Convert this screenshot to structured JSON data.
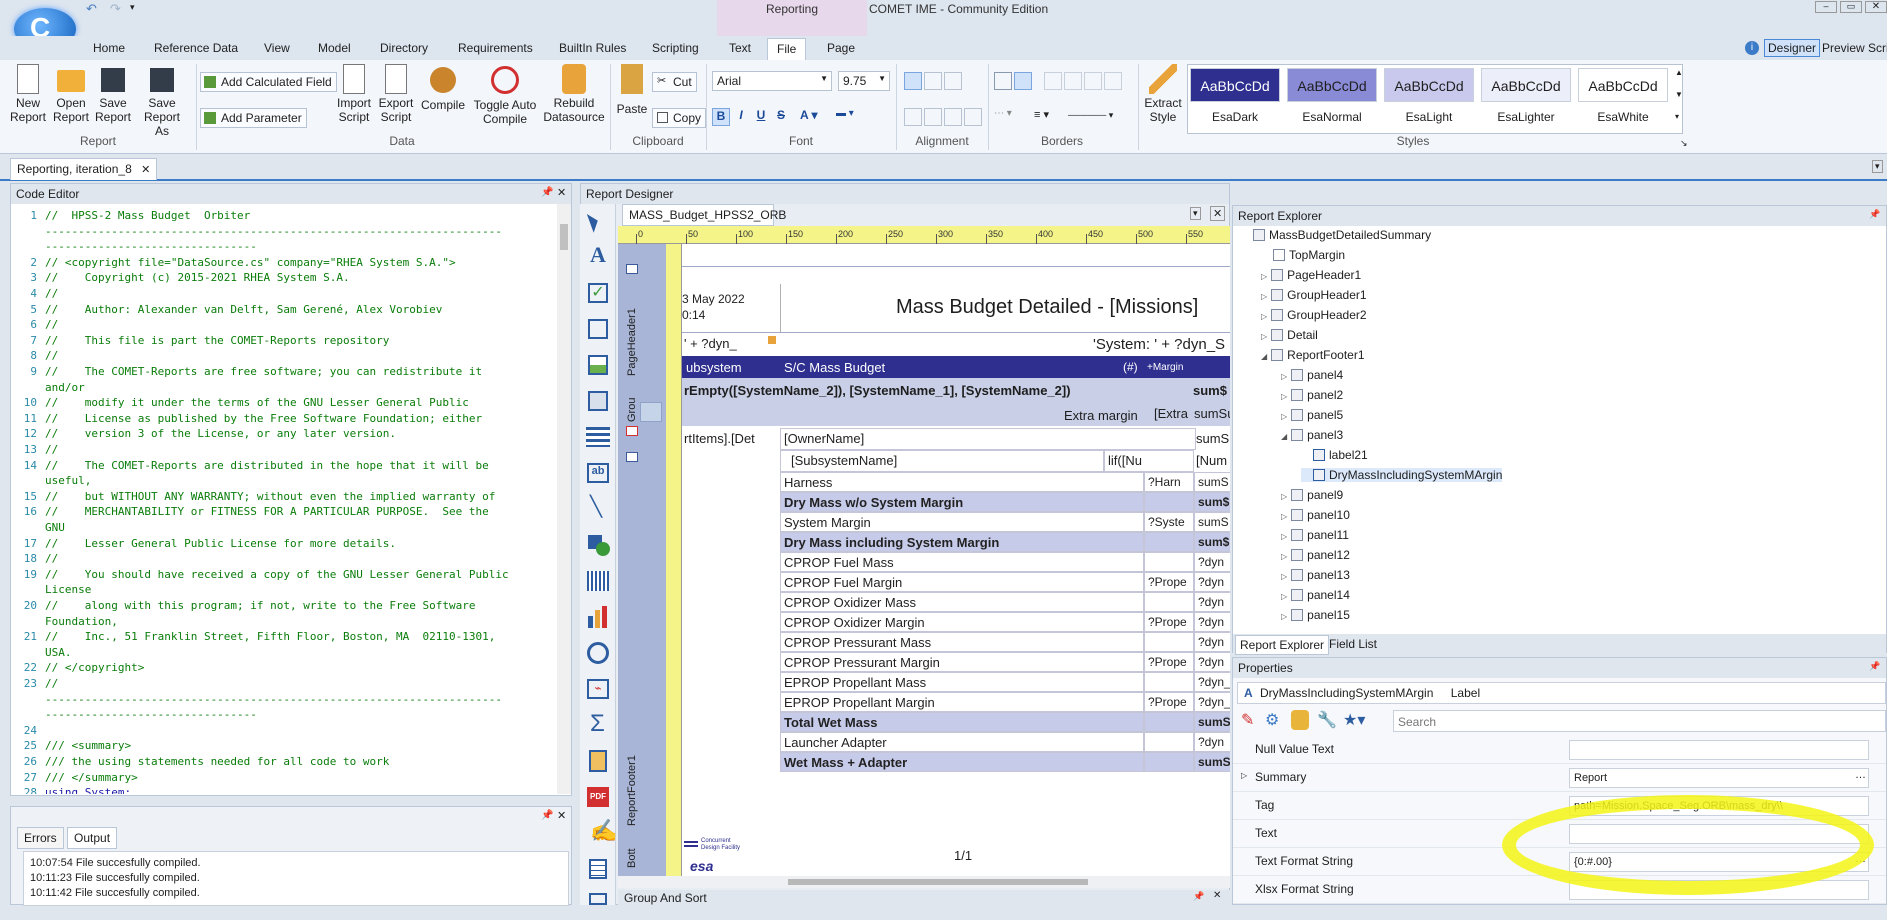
{
  "title": {
    "context_tab": "Reporting",
    "app_title": "COMET IME - Community Edition"
  },
  "ribbon": {
    "tabs": [
      "Home",
      "Reference Data",
      "View",
      "Model",
      "Directory",
      "Requirements",
      "BuiltIn Rules",
      "Scripting",
      "Text",
      "File",
      "Page"
    ],
    "active_tab": "File",
    "right": {
      "designer": "Designer",
      "preview": "Preview",
      "scripts": "Scri"
    },
    "groups": {
      "report": "Report",
      "data": "Data",
      "clipboard": "Clipboard",
      "font": "Font",
      "alignment": "Alignment",
      "borders": "Borders",
      "styles": "Styles"
    },
    "report_buttons": [
      {
        "l1": "New",
        "l2": "Report"
      },
      {
        "l1": "Open",
        "l2": "Report"
      },
      {
        "l1": "Save",
        "l2": "Report"
      },
      {
        "l1": "Save",
        "l2": "Report As"
      }
    ],
    "add_calculated_field": "Add Calculated Field",
    "add_parameter": "Add Parameter",
    "data_buttons": [
      {
        "l1": "Import",
        "l2": "Script"
      },
      {
        "l1": "Export",
        "l2": "Script"
      },
      {
        "l1": "Compile",
        "l2": ""
      },
      {
        "l1": "Toggle Auto",
        "l2": "Compile"
      },
      {
        "l1": "Rebuild",
        "l2": "Datasource"
      }
    ],
    "paste": "Paste",
    "cut": "Cut",
    "copy": "Copy",
    "font_name": "Arial",
    "font_size": "9.75",
    "extract_style": {
      "l1": "Extract",
      "l2": "Style"
    },
    "styles": [
      {
        "sample": "AaBbCcDd",
        "name": "EsaDark",
        "bg": "#2e2f8f",
        "fg": "#ffffff"
      },
      {
        "sample": "AaBbCcDd",
        "name": "EsaNormal",
        "bg": "#8a8bd6",
        "fg": "#1e1e1e"
      },
      {
        "sample": "AaBbCcDd",
        "name": "EsaLight",
        "bg": "#c9c9ee",
        "fg": "#1e1e1e"
      },
      {
        "sample": "AaBbCcDd",
        "name": "EsaLighter",
        "bg": "#eceefa",
        "fg": "#1e1e1e"
      },
      {
        "sample": "AaBbCcDd",
        "name": "EsaWhite",
        "bg": "#ffffff",
        "fg": "#1e1e1e"
      }
    ]
  },
  "doc_tab": "Reporting, iteration_8",
  "code_editor": {
    "title": "Code Editor",
    "lines": [
      {
        "n": "1",
        "t": "//  HPSS-2 Mass Budget  Orbiter"
      },
      {
        "n": "",
        "t": "---------------------------------------------------------------------"
      },
      {
        "n": "",
        "t": "--------------------------------"
      },
      {
        "n": "2",
        "t": "// <copyright file=\"DataSource.cs\" company=\"RHEA System S.A.\">"
      },
      {
        "n": "3",
        "t": "//    Copyright (c) 2015-2021 RHEA System S.A."
      },
      {
        "n": "4",
        "t": "//"
      },
      {
        "n": "5",
        "t": "//    Author: Alexander van Delft, Sam Gerené, Alex Vorobiev"
      },
      {
        "n": "6",
        "t": "//"
      },
      {
        "n": "7",
        "t": "//    This file is part the COMET-Reports repository"
      },
      {
        "n": "8",
        "t": "//"
      },
      {
        "n": "9",
        "t": "//    The COMET-Reports are free software; you can redistribute it"
      },
      {
        "n": "",
        "t": "and/or"
      },
      {
        "n": "10",
        "t": "//    modify it under the terms of the GNU Lesser General Public"
      },
      {
        "n": "11",
        "t": "//    License as published by the Free Software Foundation; either"
      },
      {
        "n": "12",
        "t": "//    version 3 of the License, or any later version."
      },
      {
        "n": "13",
        "t": "//"
      },
      {
        "n": "14",
        "t": "//    The COMET-Reports are distributed in the hope that it will be"
      },
      {
        "n": "",
        "t": "useful,"
      },
      {
        "n": "15",
        "t": "//    but WITHOUT ANY WARRANTY; without even the implied warranty of"
      },
      {
        "n": "16",
        "t": "//    MERCHANTABILITY or FITNESS FOR A PARTICULAR PURPOSE.  See the"
      },
      {
        "n": "",
        "t": "GNU"
      },
      {
        "n": "17",
        "t": "//    Lesser General Public License for more details."
      },
      {
        "n": "18",
        "t": "//"
      },
      {
        "n": "19",
        "t": "//    You should have received a copy of the GNU Lesser General Public"
      },
      {
        "n": "",
        "t": "License"
      },
      {
        "n": "20",
        "t": "//    along with this program; if not, write to the Free Software"
      },
      {
        "n": "",
        "t": "Foundation,"
      },
      {
        "n": "21",
        "t": "//    Inc., 51 Franklin Street, Fifth Floor, Boston, MA  02110-1301,"
      },
      {
        "n": "",
        "t": "USA."
      },
      {
        "n": "22",
        "t": "// </copyright>"
      },
      {
        "n": "23",
        "t": "//"
      },
      {
        "n": "",
        "t": "---------------------------------------------------------------------"
      },
      {
        "n": "",
        "t": "--------------------------------"
      },
      {
        "n": "24",
        "t": ""
      },
      {
        "n": "25",
        "t": "/// <summary>"
      },
      {
        "n": "26",
        "t": "/// the using statements needed for all code to work"
      },
      {
        "n": "27",
        "t": "/// </summary>"
      },
      {
        "n": "28",
        "t": "using System;"
      }
    ]
  },
  "output": {
    "tabs": [
      "Errors",
      "Output"
    ],
    "lines": [
      "10:07:54 File succesfully compiled.",
      "10:11:23 File succesfully compiled.",
      "10:11:42 File succesfully compiled."
    ]
  },
  "designer": {
    "title": "Report Designer",
    "doc_tab": "MASS_Budget_HPSS2_ORB",
    "ruler": [
      "0",
      "50",
      "100",
      "150",
      "200",
      "250",
      "300",
      "350",
      "400",
      "450",
      "500",
      "550"
    ],
    "bands": [
      "PageHeader1",
      "Grou",
      "ReportFooter1",
      "Bott"
    ],
    "date": "3 May 2022",
    "time": "0:14",
    "report_title": "Mass Budget Detailed - [Missions]",
    "dyn1": "' + ?dyn_",
    "system_expr": "'System: ' + ?dyn_S",
    "header": {
      "c1": "ubsystem",
      "c2": "S/C Mass Budget",
      "c3": "(#)",
      "c4": "+Margin"
    },
    "group_expr": "rEmpty([SystemName_2]), [SystemName_1], [SystemName_2])",
    "sum_s": "sum$",
    "extra_margin": "Extra margin",
    "extra": "[Extra",
    "sum_su": "sumSu",
    "row_items": "rtItems].[Det",
    "owner": "[OwnerName]",
    "sums": "sumS",
    "subsys": "[SubsystemName]",
    "lif": "lif([Nu",
    "num": "[Num",
    "rows": [
      {
        "label": "Harness",
        "mid": "?Harn",
        "right": "sumS",
        "bold": false
      },
      {
        "label": "Dry Mass w/o System Margin",
        "mid": "",
        "right": "sum$",
        "bold": true
      },
      {
        "label": "System Margin",
        "mid": "?Syste",
        "right": "sumS",
        "bold": false
      },
      {
        "label": "Dry Mass including System Margin",
        "mid": "",
        "right": "sum$",
        "bold": true
      },
      {
        "label": "CPROP Fuel Mass",
        "mid": "",
        "right": "?dyn",
        "bold": false
      },
      {
        "label": "CPROP Fuel Margin",
        "mid": "?Prope",
        "right": "?dyn",
        "bold": false
      },
      {
        "label": "CPROP Oxidizer Mass",
        "mid": "",
        "right": "?dyn",
        "bold": false
      },
      {
        "label": "CPROP Oxidizer Margin",
        "mid": "?Prope",
        "right": "?dyn",
        "bold": false
      },
      {
        "label": "CPROP Pressurant Mass",
        "mid": "",
        "right": "?dyn",
        "bold": false
      },
      {
        "label": "CPROP Pressurant Margin",
        "mid": "?Prope",
        "right": "?dyn",
        "bold": false
      },
      {
        "label": "EPROP Propellant Mass",
        "mid": "",
        "right": "?dyn_",
        "bold": false
      },
      {
        "label": "EPROP Propellant Margin",
        "mid": "?Prope",
        "right": "?dyn_",
        "bold": false
      },
      {
        "label": "Total Wet Mass",
        "mid": "",
        "right": "sumS",
        "bold": true
      },
      {
        "label": "Launcher Adapter",
        "mid": "",
        "right": "?dyn",
        "bold": false
      },
      {
        "label": "Wet Mass + Adapter",
        "mid": "",
        "right": "sumS",
        "bold": true
      }
    ],
    "page_num": "1/1",
    "cdf_logo_l1": "Concurrent",
    "cdf_logo_l2": "Design Facility",
    "esa_logo": "esa",
    "group_and_sort": "Group And Sort"
  },
  "explorer": {
    "title": "Report Explorer",
    "items": [
      {
        "label": "MassBudgetDetailedSummary",
        "level": 0,
        "exp": ""
      },
      {
        "label": "TopMargin",
        "level": 1,
        "exp": ""
      },
      {
        "label": "PageHeader1",
        "level": 1,
        "exp": "▷"
      },
      {
        "label": "GroupHeader1",
        "level": 1,
        "exp": "▷"
      },
      {
        "label": "GroupHeader2",
        "level": 1,
        "exp": "▷"
      },
      {
        "label": "Detail",
        "level": 1,
        "exp": "▷"
      },
      {
        "label": "ReportFooter1",
        "level": 1,
        "exp": "◢"
      },
      {
        "label": "panel4",
        "level": 2,
        "exp": "▷"
      },
      {
        "label": "panel2",
        "level": 2,
        "exp": "▷"
      },
      {
        "label": "panel5",
        "level": 2,
        "exp": "▷"
      },
      {
        "label": "panel3",
        "level": 2,
        "exp": "◢"
      },
      {
        "label": "label21",
        "level": 3,
        "exp": ""
      },
      {
        "label": "DryMassIncludingSystemMArgin",
        "level": 3,
        "exp": ""
      },
      {
        "label": "panel9",
        "level": 2,
        "exp": "▷"
      },
      {
        "label": "panel10",
        "level": 2,
        "exp": "▷"
      },
      {
        "label": "panel11",
        "level": 2,
        "exp": "▷"
      },
      {
        "label": "panel12",
        "level": 2,
        "exp": "▷"
      },
      {
        "label": "panel13",
        "level": 2,
        "exp": "▷"
      },
      {
        "label": "panel14",
        "level": 2,
        "exp": "▷"
      },
      {
        "label": "panel15",
        "level": 2,
        "exp": "▷"
      }
    ],
    "bottom_tabs": [
      "Report Explorer",
      "Field List"
    ]
  },
  "properties": {
    "title": "Properties",
    "selected": "DryMassIncludingSystemMArgin",
    "type": "Label",
    "search_placeholder": "Search",
    "rows": [
      {
        "label": "Null Value Text",
        "value": ""
      },
      {
        "label": "Summary",
        "value": "Report"
      },
      {
        "label": "Tag",
        "value": "path=Mission.Space_Seg.ORB\\mass_dry\\\\"
      },
      {
        "label": "Text",
        "value": ""
      },
      {
        "label": "Text Format String",
        "value": "{0:#.00}"
      },
      {
        "label": "Xlsx Format String",
        "value": ""
      }
    ]
  },
  "colors": {
    "highlight": "#f5f515",
    "band": "#c8cfe6",
    "header_row": "#2e2f8f",
    "bold_row": "#c7cbea"
  }
}
